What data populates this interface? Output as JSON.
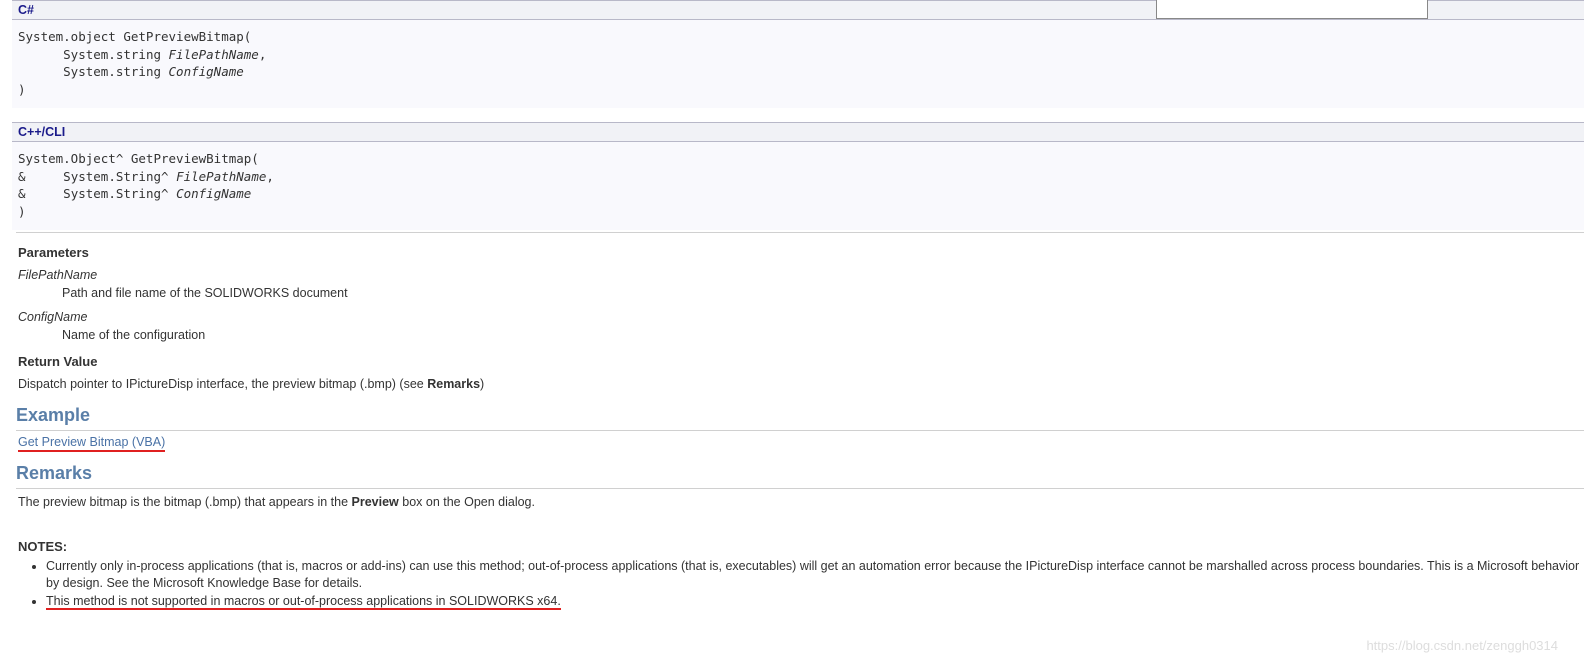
{
  "langs": {
    "csharp": {
      "title": "C#",
      "line1": "System.object GetPreviewBitmap(",
      "line2_pre": "System.string ",
      "line2_it": "FilePathName",
      "line2_post": ",",
      "line3_pre": "System.string ",
      "line3_it": "ConfigName",
      "line4": ")"
    },
    "cppcli": {
      "title": "C++/CLI",
      "line1": "System.Object^ GetPreviewBitmap(",
      "line2_amp": "&",
      "line2_pre": "System.String^ ",
      "line2_it": "FilePathName",
      "line2_post": ",",
      "line3_amp": "&",
      "line3_pre": "System.String^ ",
      "line3_it": "ConfigName",
      "line4": ")"
    }
  },
  "sections": {
    "parameters": "Parameters",
    "returnValue": "Return Value",
    "example": "Example",
    "remarks": "Remarks",
    "notes": "NOTES:"
  },
  "params": {
    "p1_name": "FilePathName",
    "p1_desc": "Path and file name of the SOLIDWORKS document",
    "p2_name": "ConfigName",
    "p2_desc": "Name of the configuration"
  },
  "returnText": {
    "pre": "Dispatch pointer to IPictureDisp interface, the preview bitmap (.bmp) (see ",
    "bold": "Remarks",
    "post": ")"
  },
  "exampleLink": "Get Preview Bitmap (VBA)",
  "remarksText": {
    "pre": "The preview bitmap is the bitmap (.bmp) that appears in the ",
    "bold": "Preview",
    "post": " box on the Open dialog."
  },
  "notesList": {
    "n1": "Currently only in-process applications (that is, macros or add-ins) can use this method; out-of-process applications (that is, executables) will get an automation error because the IPictureDisp interface cannot be marshalled across process boundaries. This is a Microsoft behavior by design. See the Microsoft Knowledge Base for details.",
    "n2": "This method is not supported in macros or out-of-process applications in SOLIDWORKS x64."
  },
  "watermark": "https://blog.csdn.net/zenggh0314"
}
